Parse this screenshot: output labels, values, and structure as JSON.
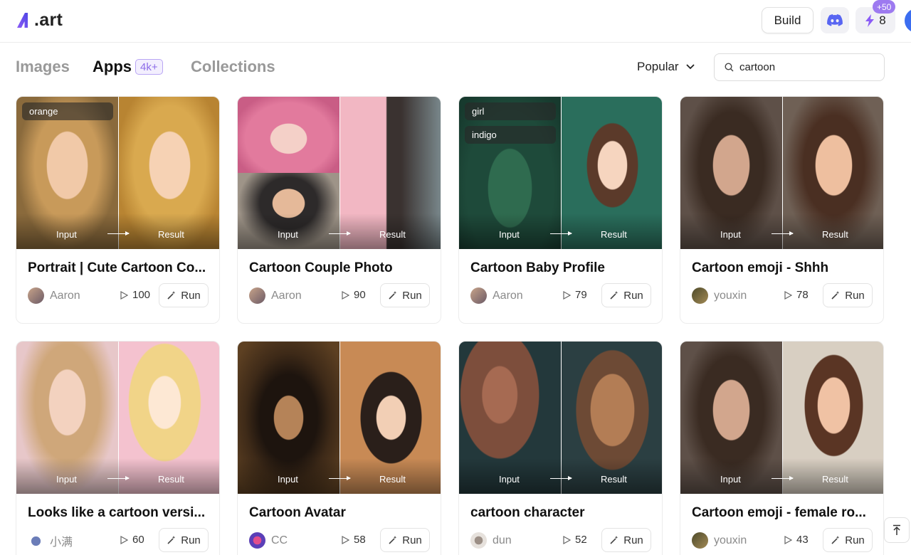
{
  "header": {
    "logo_text": ".art",
    "build_label": "Build",
    "credits_count": "8",
    "credits_badge": "+50"
  },
  "tabs": [
    {
      "label": "Images",
      "active": false
    },
    {
      "label": "Apps",
      "active": true,
      "badge": "4k+"
    },
    {
      "label": "Collections",
      "active": false
    }
  ],
  "sort": {
    "selected": "Popular"
  },
  "search": {
    "value": "cartoon"
  },
  "cards": [
    {
      "title": "Portrait | Cute Cartoon Co...",
      "author": "Aaron",
      "runs": "100",
      "tags": [
        "orange"
      ],
      "input_label": "Input",
      "result_label": "Result",
      "run_label": "Run"
    },
    {
      "title": "Cartoon Couple Photo",
      "author": "Aaron",
      "runs": "90",
      "tags": [],
      "input_label": "Input",
      "result_label": "Result",
      "run_label": "Run"
    },
    {
      "title": "Cartoon Baby Profile",
      "author": "Aaron",
      "runs": "79",
      "tags": [
        "girl",
        "indigo"
      ],
      "input_label": "Input",
      "result_label": "Result",
      "run_label": "Run"
    },
    {
      "title": "Cartoon emoji - Shhh",
      "author": "youxin",
      "runs": "78",
      "tags": [],
      "input_label": "Input",
      "result_label": "Result",
      "run_label": "Run"
    },
    {
      "title": "Looks like a cartoon versi...",
      "author": "小满",
      "runs": "60",
      "tags": [],
      "input_label": "Input",
      "result_label": "Result",
      "run_label": "Run"
    },
    {
      "title": "Cartoon Avatar",
      "author": "CC",
      "runs": "58",
      "tags": [],
      "input_label": "Input",
      "result_label": "Result",
      "run_label": "Run"
    },
    {
      "title": "cartoon character",
      "author": "dun",
      "runs": "52",
      "tags": [],
      "input_label": "Input",
      "result_label": "Result",
      "run_label": "Run"
    },
    {
      "title": "Cartoon emoji - female ro...",
      "author": "youxin",
      "runs": "43",
      "tags": [],
      "input_label": "Input",
      "result_label": "Result",
      "run_label": "Run"
    }
  ],
  "colors": {
    "accent": "#9d7af0",
    "discord": "#5865f2",
    "credits_icon": "#8b5cf6"
  }
}
